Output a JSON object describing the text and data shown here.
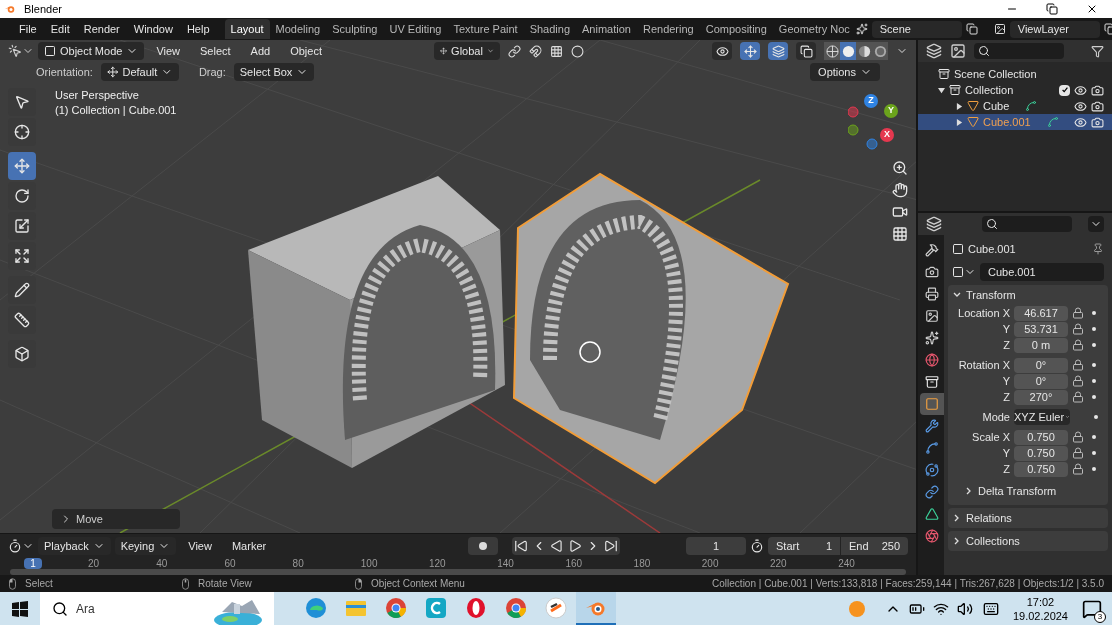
{
  "window": {
    "title": "Blender"
  },
  "menu": [
    "File",
    "Edit",
    "Render",
    "Window",
    "Help"
  ],
  "workspaces": [
    {
      "label": "Layout",
      "selected": true
    },
    {
      "label": "Modeling",
      "selected": false
    },
    {
      "label": "Sculpting",
      "selected": false
    },
    {
      "label": "UV Editing",
      "selected": false
    },
    {
      "label": "Texture Paint",
      "selected": false
    },
    {
      "label": "Shading",
      "selected": false
    },
    {
      "label": "Animation",
      "selected": false
    },
    {
      "label": "Rendering",
      "selected": false
    },
    {
      "label": "Compositing",
      "selected": false
    },
    {
      "label": "Geometry Noc",
      "selected": false
    }
  ],
  "scene": "Scene",
  "view_layer": "ViewLayer",
  "viewport_header": {
    "mode": "Object Mode",
    "menus": [
      "View",
      "Select",
      "Add",
      "Object"
    ],
    "orientation": "Global",
    "toggles": [
      {
        "kind": "visibility",
        "on": false
      },
      {
        "kind": "gizmo",
        "on": true
      },
      {
        "kind": "overlay",
        "on": true
      },
      {
        "kind": "xray",
        "on": false
      }
    ],
    "shading": [
      {
        "kind": "wireframe",
        "selected": false
      },
      {
        "kind": "solid",
        "selected": true
      },
      {
        "kind": "material",
        "selected": false
      },
      {
        "kind": "rendered",
        "selected": false
      }
    ]
  },
  "tool_settings": {
    "orientation_label": "Orientation:",
    "orientation": "Default",
    "drag_label": "Drag:",
    "drag": "Select Box",
    "options": "Options"
  },
  "viewport": {
    "overlay": [
      "User Perspective",
      "(1) Collection | Cube.001"
    ],
    "tools": [
      {
        "kind": "select",
        "selected": false
      },
      {
        "kind": "cursor",
        "selected": false
      },
      {
        "kind": "move",
        "selected": true
      },
      {
        "kind": "rotate",
        "selected": false
      },
      {
        "kind": "scale",
        "selected": false
      },
      {
        "kind": "transform",
        "selected": false
      },
      {
        "kind": "annotate",
        "selected": false
      },
      {
        "kind": "measure",
        "selected": false
      },
      {
        "kind": "add-cube",
        "selected": false
      }
    ],
    "gizmo_axes": [
      {
        "label": "Z",
        "color": "#2f83e3"
      },
      {
        "label": "Y",
        "color": "#6ba31c"
      },
      {
        "label": "X",
        "color": "#e5384f"
      }
    ],
    "last_operator": "Move"
  },
  "outliner": {
    "root": "Scene Collection",
    "items": [
      {
        "label": "Collection",
        "selected": false,
        "expanded": true,
        "checked": true,
        "children": [
          {
            "label": "Cube",
            "selected": false,
            "expanded": false
          },
          {
            "label": "Cube.001",
            "selected": true,
            "expanded": false
          }
        ]
      }
    ]
  },
  "properties": {
    "tabs": [
      {
        "kind": "tool",
        "selected": false
      },
      {
        "kind": "render",
        "selected": false
      },
      {
        "kind": "output",
        "selected": false
      },
      {
        "kind": "view-layer",
        "selected": false
      },
      {
        "kind": "scene",
        "selected": false
      },
      {
        "kind": "world",
        "selected": false
      },
      {
        "kind": "collection",
        "selected": false
      },
      {
        "kind": "object",
        "selected": true
      },
      {
        "kind": "modifiers",
        "selected": false
      },
      {
        "kind": "particles",
        "selected": false
      },
      {
        "kind": "physics",
        "selected": false
      },
      {
        "kind": "constraints",
        "selected": false
      },
      {
        "kind": "data",
        "selected": false
      },
      {
        "kind": "material",
        "selected": false
      }
    ],
    "object_name": "Cube.001",
    "data_name": "Cube.001",
    "transform": {
      "title": "Transform",
      "expanded": true,
      "groups": [
        {
          "kind": "fields",
          "rows": [
            {
              "label": "Location X",
              "value": "46.617"
            },
            {
              "label": "Y",
              "value": "53.731"
            },
            {
              "label": "Z",
              "value": "0 m"
            }
          ]
        },
        {
          "kind": "fields",
          "rows": [
            {
              "label": "Rotation X",
              "value": "0°"
            },
            {
              "label": "Y",
              "value": "0°"
            },
            {
              "label": "Z",
              "value": "270°"
            }
          ]
        },
        {
          "kind": "dropdown",
          "rows": [
            {
              "label": "Mode",
              "value": "XYZ Euler"
            }
          ]
        },
        {
          "kind": "fields",
          "rows": [
            {
              "label": "Scale X",
              "value": "0.750"
            },
            {
              "label": "Y",
              "value": "0.750"
            },
            {
              "label": "Z",
              "value": "0.750"
            }
          ]
        }
      ],
      "subpanels": [
        {
          "title": "Delta Transform",
          "expanded": false
        }
      ]
    },
    "panels": [
      {
        "title": "Relations",
        "expanded": false
      },
      {
        "title": "Collections",
        "expanded": false
      }
    ]
  },
  "timeline": {
    "menus": [
      "Playback",
      "Keying",
      "View",
      "Marker"
    ],
    "current_frame": "1",
    "start_label": "Start",
    "start": "1",
    "end_label": "End",
    "end": "250",
    "playhead": "1",
    "ruler": [
      "20",
      "40",
      "60",
      "80",
      "100",
      "120",
      "140",
      "160",
      "180",
      "200",
      "220",
      "240"
    ]
  },
  "status_bar": {
    "hints": [
      {
        "kind": "left",
        "label": "Select"
      },
      {
        "kind": "middle",
        "label": "Rotate View"
      },
      {
        "kind": "right",
        "label": "Object Context Menu"
      }
    ],
    "stats": "Collection | Cube.001 | Verts:133,818 | Faces:259,144 | Tris:267,628 | Objects:1/2 | 3.5.0"
  },
  "taskbar": {
    "search": {
      "placeholder": "Ara"
    },
    "apps": [
      {
        "kind": "edge",
        "selected": false
      },
      {
        "kind": "explorer",
        "selected": false
      },
      {
        "kind": "chrome",
        "selected": false
      },
      {
        "kind": "c-app",
        "selected": false
      },
      {
        "kind": "opera",
        "selected": false
      },
      {
        "kind": "chrome",
        "selected": false
      },
      {
        "kind": "s-app",
        "selected": false
      },
      {
        "kind": "blender",
        "selected": true
      }
    ],
    "time": "17:02",
    "date": "19.02.2024",
    "notifications": "3"
  }
}
